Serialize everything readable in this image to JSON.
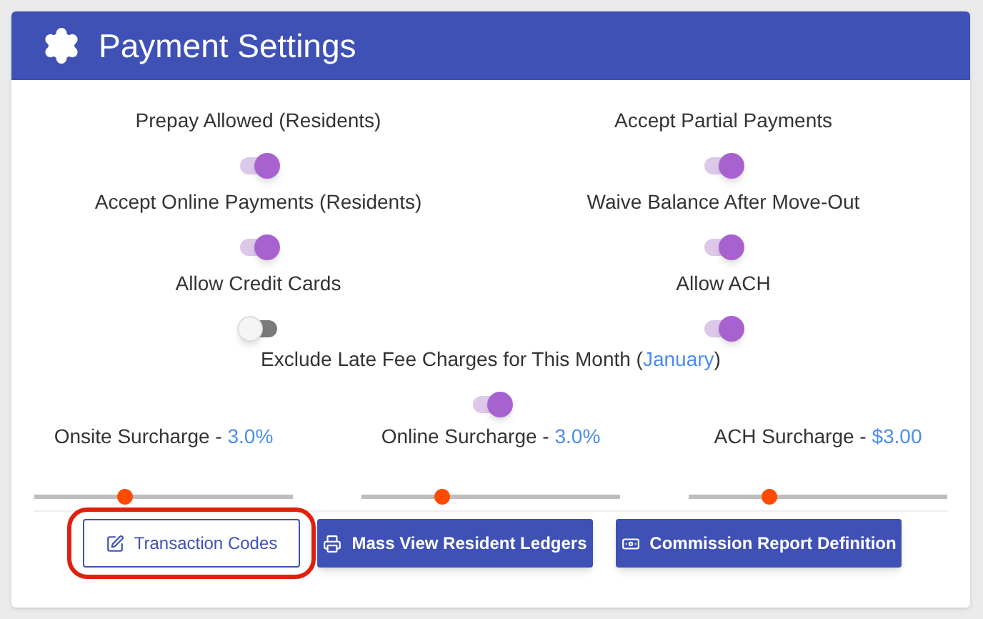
{
  "header": {
    "title": "Payment Settings"
  },
  "toggles": [
    {
      "label": "Prepay Allowed (Residents)",
      "on": true
    },
    {
      "label": "Accept Partial Payments",
      "on": true
    },
    {
      "label": "Accept Online Payments (Residents)",
      "on": true
    },
    {
      "label": "Waive Balance After Move-Out",
      "on": true
    },
    {
      "label": "Allow Credit Cards",
      "on": false
    },
    {
      "label": "Allow ACH",
      "on": true
    }
  ],
  "late_fee": {
    "label_start": "Exclude Late Fee Charges for This Month (",
    "month": "January",
    "label_end": ")",
    "on": true
  },
  "surcharges": [
    {
      "label": "Onsite Surcharge - ",
      "value": "3.0%",
      "level": 0.35
    },
    {
      "label": "Online Surcharge - ",
      "value": "3.0%",
      "level": 0.31
    },
    {
      "label": "ACH Surcharge - ",
      "value": "$3.00",
      "level": 0.31
    }
  ],
  "buttons": [
    {
      "label": "Transaction Codes",
      "kind": "outline",
      "highlighted": true
    },
    {
      "label": "Mass View Resident Ledgers",
      "kind": "filled",
      "highlighted": false
    },
    {
      "label": "Commission Report Definition",
      "kind": "filled",
      "highlighted": false
    }
  ]
}
